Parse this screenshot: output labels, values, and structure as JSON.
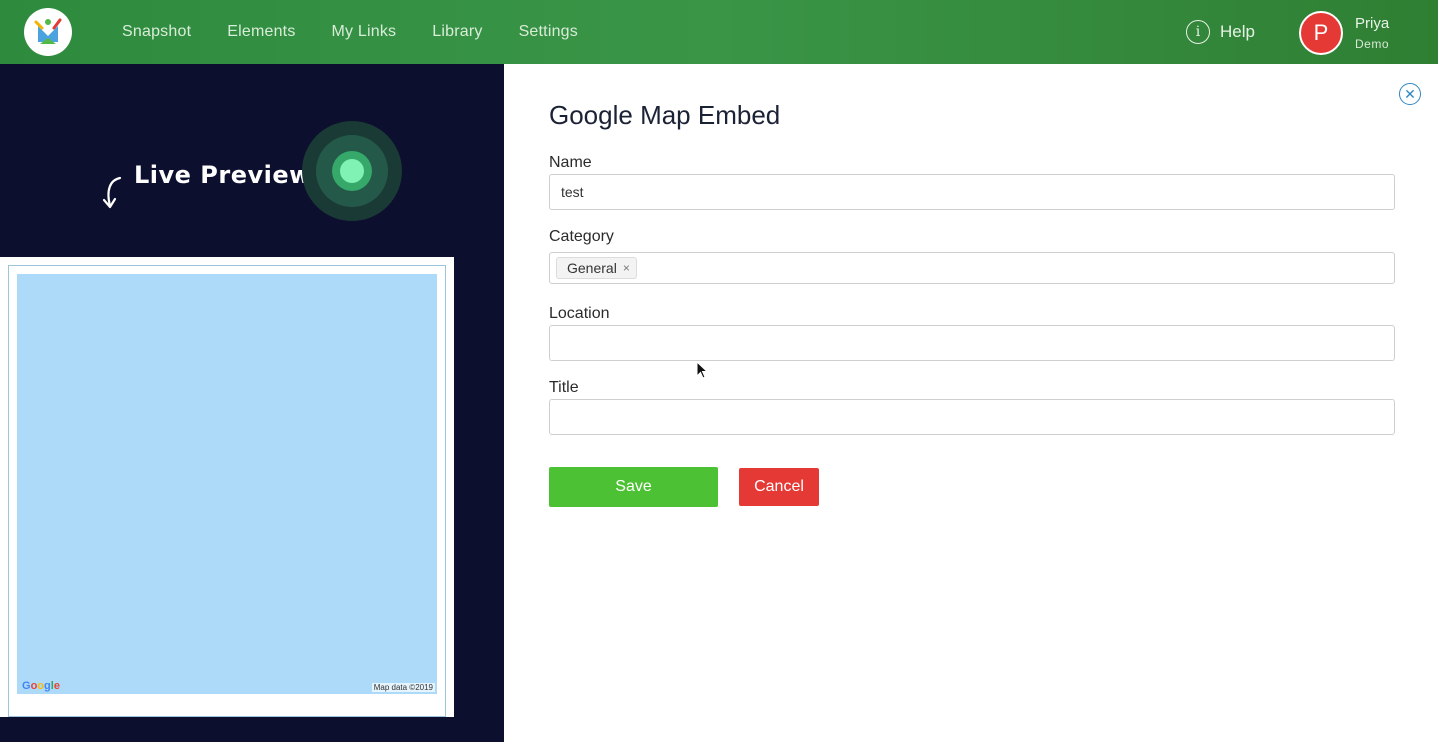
{
  "nav": {
    "items": [
      "Snapshot",
      "Elements",
      "My Links",
      "Library",
      "Settings"
    ],
    "help_label": "Help",
    "help_icon": "info-icon"
  },
  "user": {
    "initial": "P",
    "name": "Priya",
    "role": "Demo",
    "avatar_color": "#e53935"
  },
  "preview": {
    "heading": "Live Preview",
    "map_logo": "Google",
    "map_attribution": "Map data ©2019"
  },
  "form": {
    "title": "Google Map Embed",
    "name_label": "Name",
    "name_value": "test",
    "category_label": "Category",
    "category_tags": [
      "General"
    ],
    "location_label": "Location",
    "location_value": "",
    "title_label": "Title",
    "title_value": "",
    "save_label": "Save",
    "cancel_label": "Cancel"
  },
  "colors": {
    "header_green": "#3a9547",
    "preview_bg": "#0d0f2e",
    "map_water": "#acdaf8",
    "save_green": "#4cc133",
    "cancel_red": "#e53935",
    "close_blue": "#2f86c4"
  }
}
